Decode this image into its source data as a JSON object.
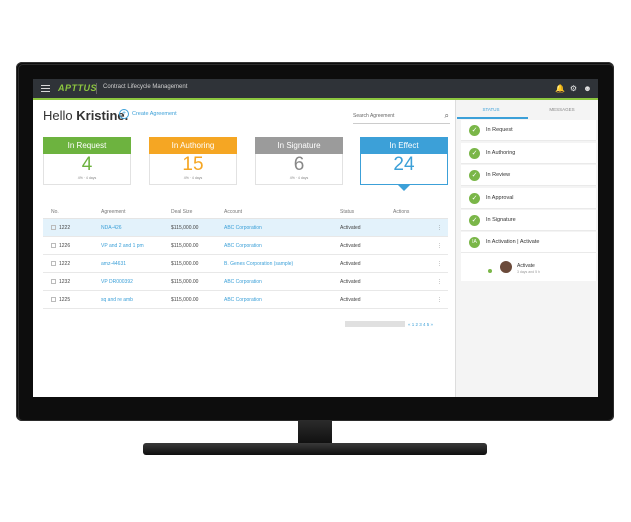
{
  "app": {
    "logo": "APTTUS",
    "title": "Contract Lifecycle Management"
  },
  "greeting": {
    "hello": "Hello ",
    "name": "Kristine."
  },
  "create_label": "Create Agreement",
  "search": {
    "placeholder": "Search Agreement"
  },
  "cards": [
    {
      "label": "In Request",
      "count": "4",
      "sub": "4% · 4 days",
      "color": "#6db33f"
    },
    {
      "label": "In Authoring",
      "count": "15",
      "sub": "4% · 4 days",
      "color": "#f5a623"
    },
    {
      "label": "In Signature",
      "count": "6",
      "sub": "4% · 4 days",
      "color": "#9b9b9b"
    },
    {
      "label": "In Effect",
      "count": "24",
      "sub": "",
      "color": "#3ca0d8"
    }
  ],
  "table": {
    "headers": [
      "No.",
      "Agreement",
      "Deal Size",
      "Account",
      "Status",
      "Actions"
    ],
    "rows": [
      {
        "no": "1222",
        "agreement": "NDA-426",
        "deal": "$115,000.00",
        "account": "ABC Corporation",
        "status": "Activated"
      },
      {
        "no": "1226",
        "agreement": "VP and 2 and 1 pm",
        "deal": "$115,000.00",
        "account": "ABC Corporation",
        "status": "Activated"
      },
      {
        "no": "1222",
        "agreement": "amz-44631",
        "deal": "$115,000.00",
        "account": "B. Genes Corporation (sample)",
        "status": "Activated"
      },
      {
        "no": "1232",
        "agreement": "VP DR000392",
        "deal": "$115,000.00",
        "account": "ABC Corporation",
        "status": "Activated"
      },
      {
        "no": "1225",
        "agreement": "sq and re amb",
        "deal": "$115,000.00",
        "account": "ABC Corporation",
        "status": "Activated"
      }
    ]
  },
  "pager": "« 1 2 3 4 5 »",
  "panel": {
    "tabs": [
      "STATUS",
      "MESSAGES"
    ],
    "steps": [
      "In Request",
      "In Authoring",
      "In Review",
      "In Approval",
      "In Signature"
    ],
    "current_step": {
      "badge": "IA",
      "label": "In Activation | Activate"
    },
    "activity": {
      "name": "Activate",
      "time": "3 days and 5 h"
    }
  }
}
